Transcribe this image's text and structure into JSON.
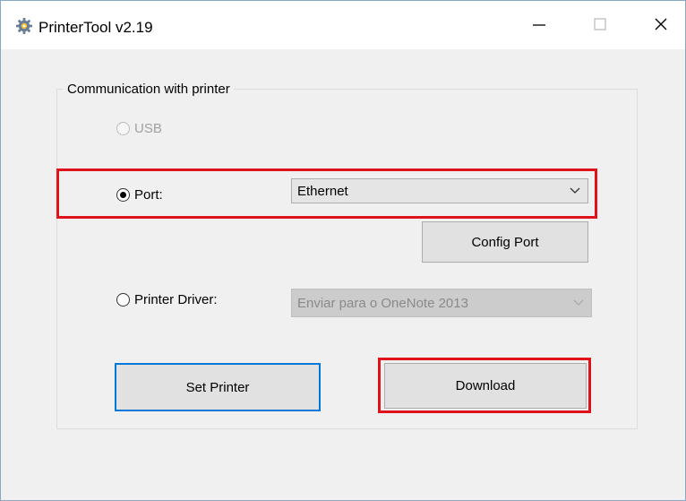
{
  "window": {
    "title": "PrinterTool v2.19",
    "icon": "gear-icon",
    "controls": {
      "minimize": "—",
      "maximize": "☐",
      "close": "✕"
    }
  },
  "group": {
    "label": "Communication with printer"
  },
  "usb": {
    "label": "USB",
    "checked": false,
    "enabled": false
  },
  "port": {
    "label": "Port:",
    "checked": true,
    "selected_value": "Ethernet"
  },
  "config_port_button": {
    "label": "Config Port"
  },
  "printer_driver": {
    "label": "Printer Driver:",
    "checked": false,
    "selected_value": "Enviar para o OneNote 2013",
    "enabled": false
  },
  "buttons": {
    "set_printer": "Set Printer",
    "download": "Download"
  },
  "colors": {
    "highlight": "#e0121c",
    "focus": "#0078d7"
  }
}
